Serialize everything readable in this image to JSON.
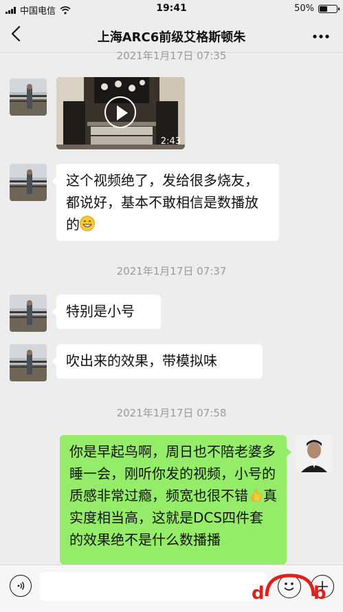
{
  "status_bar": {
    "carrier": "中国电信",
    "time": "19:41",
    "battery": "50%",
    "battery_level": 0.5
  },
  "header": {
    "title": "上海ARC6前级艾格斯顿朱",
    "back_icon": "chevron-left-icon",
    "more_icon": "more-dots-icon"
  },
  "messages": {
    "ts1": "2021年1月17日 07:35",
    "video_duration": "2:43",
    "msg1": "这个视频绝了，发给很多烧友，都说好，基本不敢相信是数播放的",
    "ts2": "2021年1月17日 07:37",
    "msg2": "特别是小号",
    "msg3": "吹出来的效果，带模拟味",
    "ts3": "2021年1月17日 07:58",
    "msg4_part1": "你是早起鸟啊，周日也不陪老婆多睡一会，刚听你发的视频，小号的质感非常过瘾，频宽也很不错",
    "msg4_part2": "真实度相当高，这就是DCS四件套的效果绝不是什么数播播"
  },
  "input_bar": {
    "voice_icon": "voice-icon",
    "emoji_icon": "emoji-icon",
    "plus_icon": "plus-icon"
  },
  "colors": {
    "background": "#ededed",
    "bubble_self": "#95ec69",
    "bubble_other": "#ffffff",
    "timestamp": "#9a9a9a"
  }
}
